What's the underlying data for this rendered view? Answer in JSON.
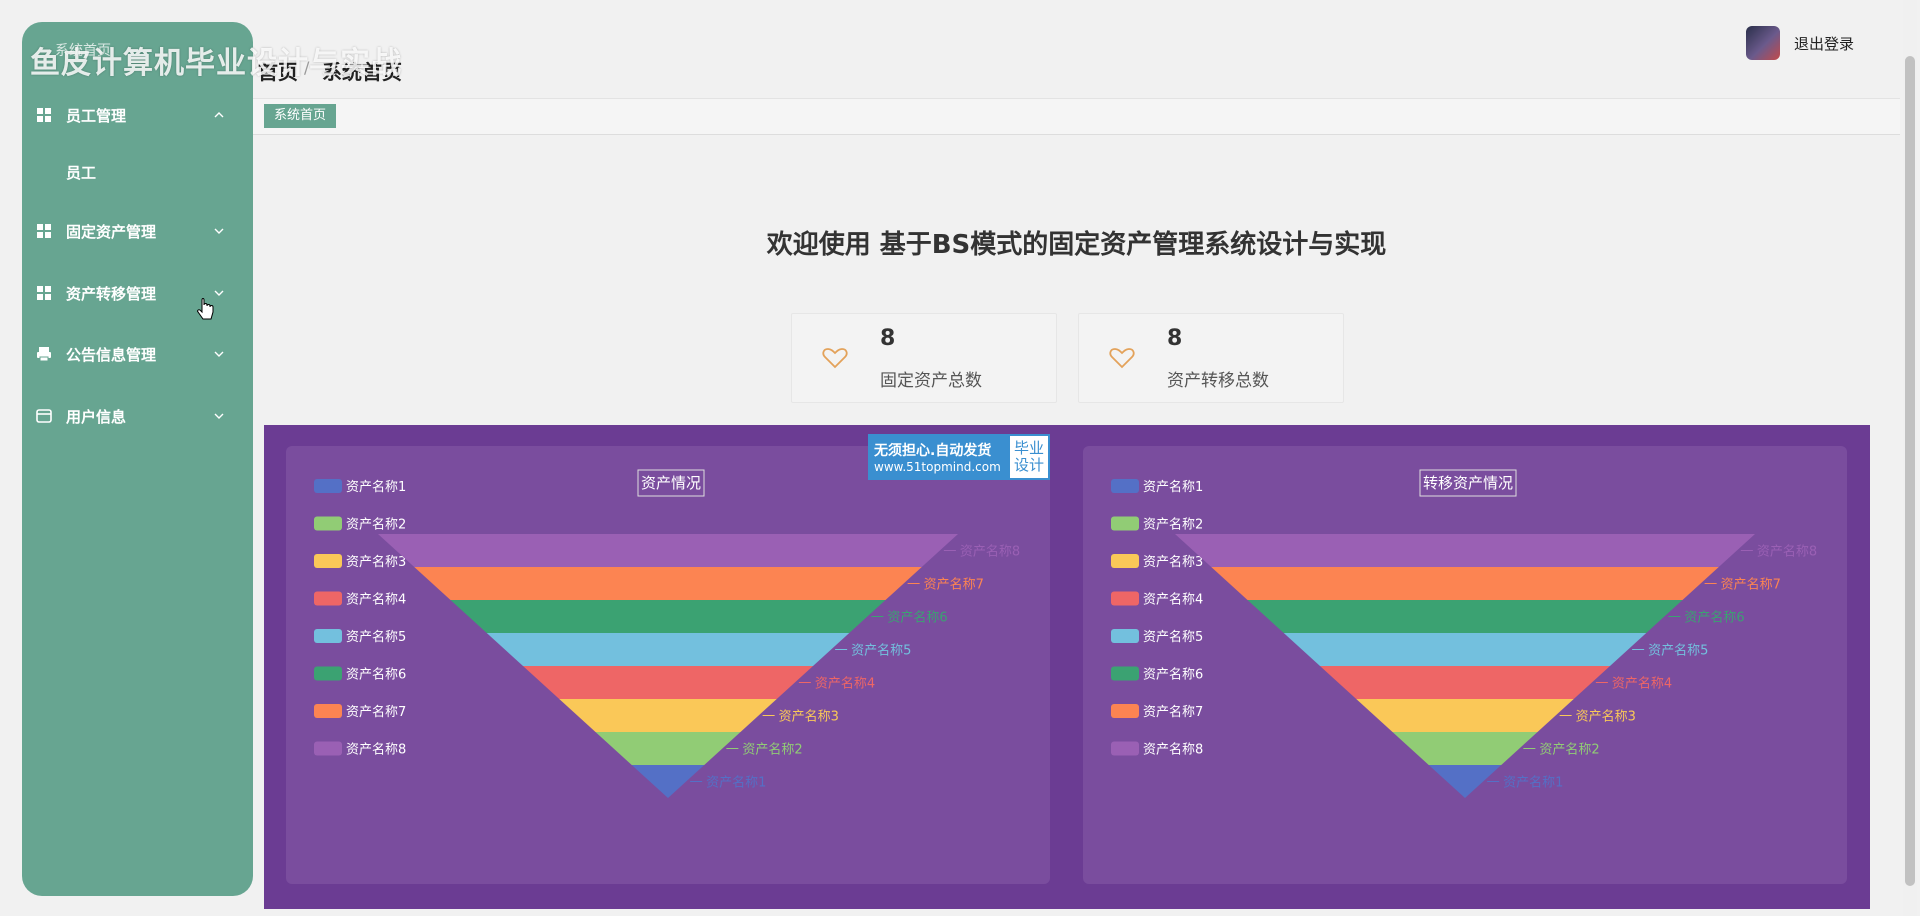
{
  "watermark": {
    "text": "鱼皮计算机毕业设计与实战"
  },
  "sidebar": {
    "system_home": "系统首页",
    "menus": [
      {
        "label": "员工管理",
        "icon": "grid-icon",
        "expanded": true
      },
      {
        "label": "固定资产管理",
        "icon": "grid-icon",
        "expanded": false
      },
      {
        "label": "资产转移管理",
        "icon": "grid-icon",
        "expanded": false
      },
      {
        "label": "公告信息管理",
        "icon": "printer-icon",
        "expanded": false
      },
      {
        "label": "用户信息",
        "icon": "card-icon",
        "expanded": false
      }
    ],
    "submenu_employee": "员工"
  },
  "header": {
    "crumb_home": "首页",
    "crumb_sep": "/",
    "crumb_current": "系统首页",
    "logout": "退出登录"
  },
  "tabs": {
    "active": "系统首页"
  },
  "welcome": "欢迎使用 基于BS模式的固定资产管理系统设计与实现",
  "stats": [
    {
      "value": "8",
      "label": "固定资产总数",
      "icon": "heart-icon"
    },
    {
      "value": "8",
      "label": "资产转移总数",
      "icon": "heart-icon"
    }
  ],
  "promo": {
    "line1": "无须担心.自动发货",
    "line2": "www.51topmind.com",
    "right1": "毕业",
    "right2": "设计"
  },
  "colors": {
    "sidebar": "#67a591",
    "chart_bg": "#6b3c93",
    "panel_bg": "#7a4d9e",
    "heart": "#e3a25a"
  },
  "chart_data": [
    {
      "type": "funnel",
      "title": "资产情况",
      "legend_position": "left",
      "categories": [
        "资产名称1",
        "资产名称2",
        "资产名称3",
        "资产名称4",
        "资产名称5",
        "资产名称6",
        "资产名称7",
        "资产名称8"
      ],
      "values": [
        1,
        2,
        3,
        4,
        5,
        6,
        7,
        8
      ],
      "colors": [
        "#5470c6",
        "#91cc75",
        "#fac858",
        "#ee6666",
        "#73c0de",
        "#3ba272",
        "#fc8452",
        "#9a60b4"
      ]
    },
    {
      "type": "funnel",
      "title": "转移资产情况",
      "legend_position": "left",
      "categories": [
        "资产名称1",
        "资产名称2",
        "资产名称3",
        "资产名称4",
        "资产名称5",
        "资产名称6",
        "资产名称7",
        "资产名称8"
      ],
      "values": [
        1,
        2,
        3,
        4,
        5,
        6,
        7,
        8
      ],
      "colors": [
        "#5470c6",
        "#91cc75",
        "#fac858",
        "#ee6666",
        "#73c0de",
        "#3ba272",
        "#fc8452",
        "#9a60b4"
      ]
    }
  ]
}
